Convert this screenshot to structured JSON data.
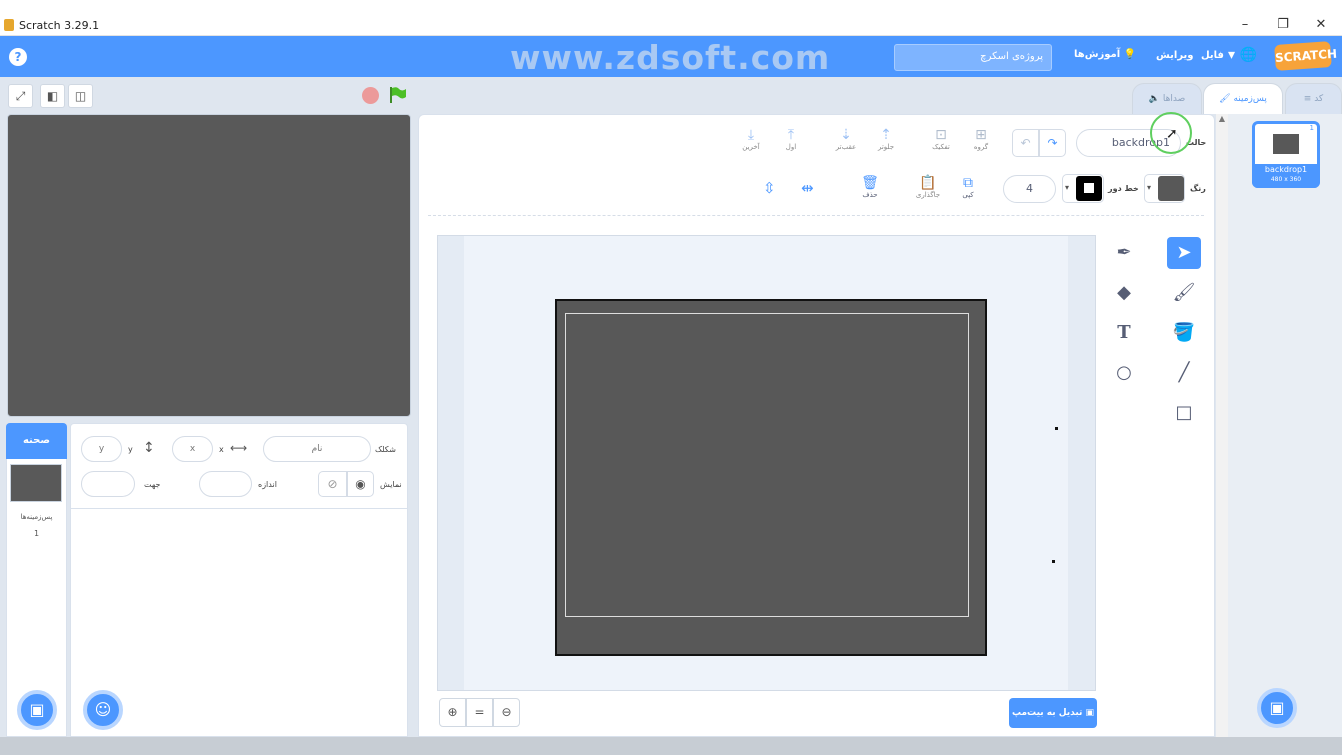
{
  "window": {
    "title": "Scratch 3.29.1",
    "controls": [
      "–",
      "❐",
      "✕"
    ]
  },
  "menubar": {
    "help_label": "?",
    "watermark": "www.zdsoft.com",
    "project_name": "پروژه‌ی اسکرچ",
    "tutorials": "آموزش‌ها",
    "edit": "ویرایش",
    "file": "فایل",
    "logo": "SCRATCH"
  },
  "stage_controls": {
    "fullscreen": "⤢",
    "small": "◧",
    "large": "◫"
  },
  "sprite_info": {
    "sprite_label": "شکلک",
    "name_placeholder": "نام",
    "x_label": "x",
    "x_placeholder": "x",
    "y_label": "y",
    "y_placeholder": "y",
    "show_label": "نمایش",
    "size_label": "اندازه",
    "direction_label": "جهت"
  },
  "stage_column": {
    "header": "صحنه",
    "backdrops_label": "پس‌زمینه‌ها",
    "backdrops_count": "1"
  },
  "tabs": {
    "code": "کد",
    "backdrops": "پس‌زمینه",
    "sounds": "صداها"
  },
  "paint": {
    "mode_label": "حالت",
    "costume_name": "backdrop1",
    "group": "گروه",
    "ungroup": "تفکیک",
    "forward": "جلوتر",
    "backward": "عقب‌تر",
    "front": "اول",
    "back": "آخرین",
    "fill_label": "رنگ",
    "outline_label": "خط دور",
    "outline_width": "4",
    "copy": "کپی",
    "paste": "جاگذاری",
    "delete": "حذف",
    "convert_button": "تبدیل به بیت‌مپ"
  },
  "costume_list": {
    "index": "1",
    "name": "backdrop1",
    "size": "480 x 360"
  },
  "colors": {
    "accent": "#4c97ff",
    "canvas": "#585858"
  }
}
